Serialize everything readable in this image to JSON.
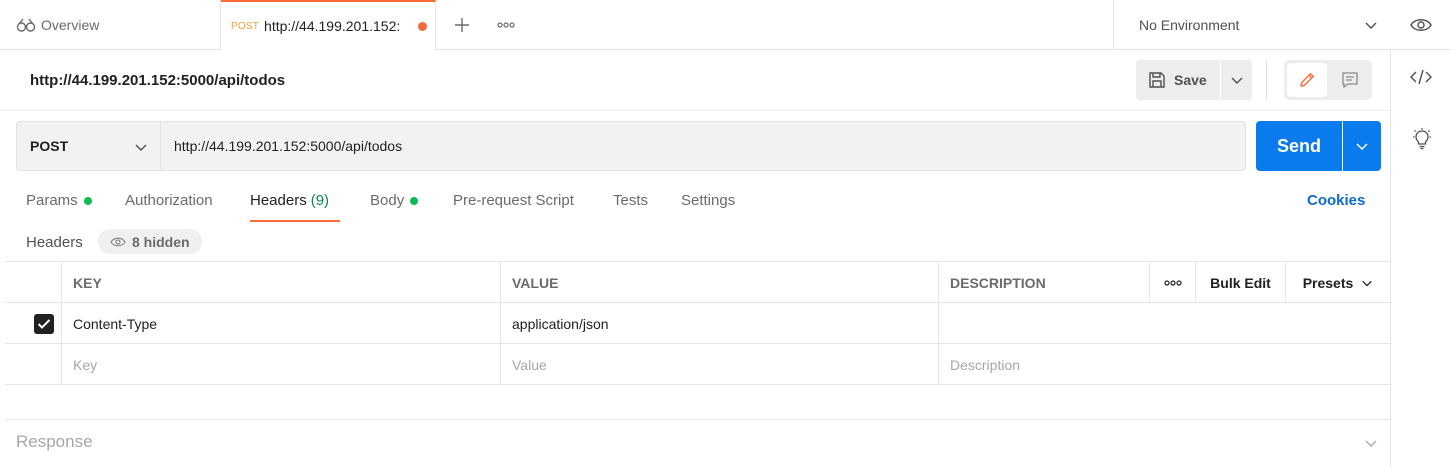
{
  "tabbar": {
    "overview_label": "Overview",
    "active_tab": {
      "method": "POST",
      "title": "http://44.199.201.152:",
      "unsaved": true
    },
    "environment": "No Environment"
  },
  "request": {
    "name": "http://44.199.201.152:5000/api/todos",
    "save_label": "Save",
    "method": "POST",
    "url": "http://44.199.201.152:5000/api/todos",
    "send_label": "Send"
  },
  "tabs": [
    {
      "label": "Params",
      "dot": true
    },
    {
      "label": "Authorization"
    },
    {
      "label": "Headers",
      "count": "(9)",
      "active": true
    },
    {
      "label": "Body",
      "dot": true
    },
    {
      "label": "Pre-request Script"
    },
    {
      "label": "Tests"
    },
    {
      "label": "Settings"
    }
  ],
  "cookies_label": "Cookies",
  "headers_section": {
    "label": "Headers",
    "hidden_label": "8 hidden"
  },
  "table": {
    "columns": {
      "key": "KEY",
      "value": "VALUE",
      "description": "DESCRIPTION",
      "bulk_edit": "Bulk Edit",
      "presets": "Presets"
    },
    "rows": [
      {
        "checked": true,
        "key": "Content-Type",
        "value": "application/json",
        "description": ""
      }
    ],
    "placeholders": {
      "key": "Key",
      "value": "Value",
      "description": "Description"
    }
  },
  "response": {
    "label": "Response"
  },
  "colors": {
    "accent": "#ff6c37",
    "send": "#097bed",
    "link": "#0b6bcb",
    "active_dot": "#0cbb52"
  }
}
